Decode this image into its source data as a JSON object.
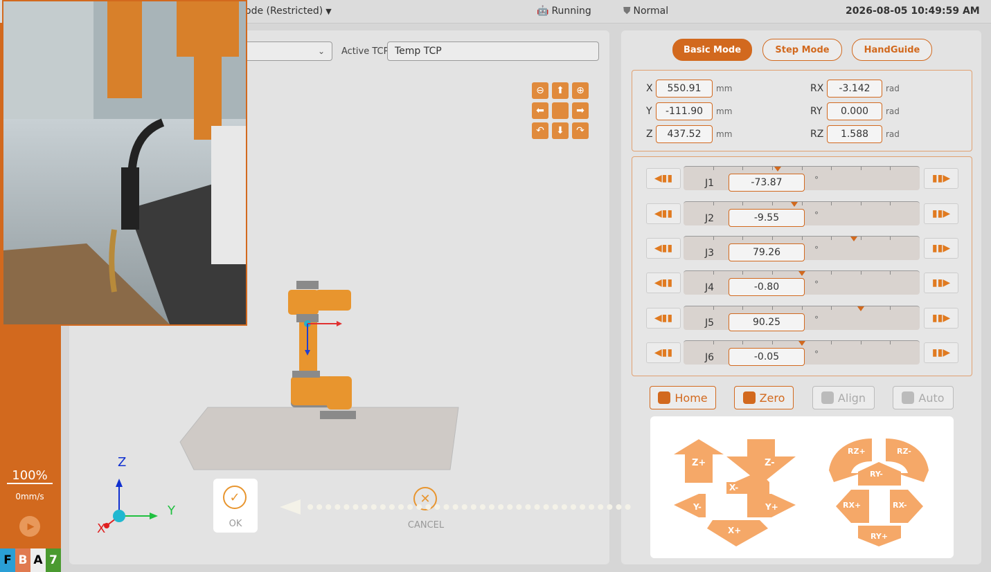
{
  "header": {
    "mode_label": "ode (Restricted)",
    "status": "Running",
    "safety": "Normal",
    "datetime": "2026-08-05 10:49:59 AM"
  },
  "sidebar": {
    "speed_percent": "100%",
    "speed_mm": "0mm/s",
    "badges": [
      "F",
      "B",
      "A",
      "7"
    ]
  },
  "viewer": {
    "active_tcp_label": "Active TCP",
    "active_tcp_value": "Temp TCP",
    "axis_z": "Z",
    "axis_y": "Y",
    "axis_x": "X",
    "ok_label": "OK",
    "cancel_label": "CANCEL"
  },
  "modes": {
    "basic": "Basic Mode",
    "step": "Step Mode",
    "handguide": "HandGuide"
  },
  "pose": {
    "X": {
      "label": "X",
      "value": "550.91",
      "unit": "mm"
    },
    "Y": {
      "label": "Y",
      "value": "-111.90",
      "unit": "mm"
    },
    "Z": {
      "label": "Z",
      "value": "437.52",
      "unit": "mm"
    },
    "RX": {
      "label": "RX",
      "value": "-3.142",
      "unit": "rad"
    },
    "RY": {
      "label": "RY",
      "value": "0.000",
      "unit": "rad"
    },
    "RZ": {
      "label": "RZ",
      "value": "1.588",
      "unit": "rad"
    }
  },
  "joints": [
    {
      "name": "J1",
      "value": "-73.87",
      "unit": "°",
      "pos": 0.4
    },
    {
      "name": "J2",
      "value": "-9.55",
      "unit": "°",
      "pos": 0.47
    },
    {
      "name": "J3",
      "value": "79.26",
      "unit": "°",
      "pos": 0.72
    },
    {
      "name": "J4",
      "value": "-0.80",
      "unit": "°",
      "pos": 0.5
    },
    {
      "name": "J5",
      "value": "90.25",
      "unit": "°",
      "pos": 0.75
    },
    {
      "name": "J6",
      "value": "-0.05",
      "unit": "°",
      "pos": 0.5
    }
  ],
  "actions": {
    "home": "Home",
    "zero": "Zero",
    "align": "Align",
    "auto": "Auto"
  },
  "jogpad": {
    "zplus": "Z+",
    "zminus": "Z-",
    "xminus": "X-",
    "xplus": "X+",
    "yminus": "Y-",
    "yplus": "Y+",
    "rzplus": "RZ+",
    "rzminus": "RZ-",
    "ryminus": "RY-",
    "ryplus": "RY+",
    "rxplus": "RX+",
    "rxminus": "RX-"
  },
  "colors": {
    "accent": "#d2691e",
    "accent_light": "#f0a060"
  }
}
